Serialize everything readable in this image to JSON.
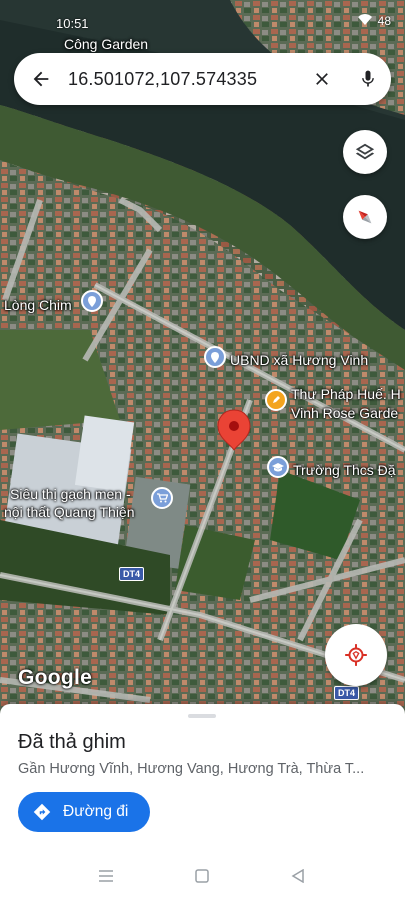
{
  "status": {
    "time": "10:51",
    "battery": "48"
  },
  "search": {
    "query": "16.501072,107.574335"
  },
  "map": {
    "top_place": "Công Garden",
    "labels": [
      {
        "text": "Lòng Chim"
      },
      {
        "text": "UBND xã Hương Vinh"
      },
      {
        "text": "Thư Pháp Huế. H"
      },
      {
        "text": "Vinh Rose Garde"
      },
      {
        "text": "Trường Thcs Đặ"
      },
      {
        "text": "Siêu thị gạch men -"
      },
      {
        "text": "nội thất Quang Thiện"
      }
    ],
    "road_badge": "DT4",
    "road_badge_2": "DT4",
    "attribution": "Google"
  },
  "sheet": {
    "title": "Đã thả ghim",
    "subtitle": "Gần Hương Vĩnh, Hương Vang, Hương Trà, Thừa T...",
    "directions_label": "Đường đi"
  },
  "colors": {
    "accent": "#1a73e8",
    "pin": "#ea4335",
    "poi_blue": "#7b9fd9",
    "poi_orange": "#f3a41e"
  }
}
